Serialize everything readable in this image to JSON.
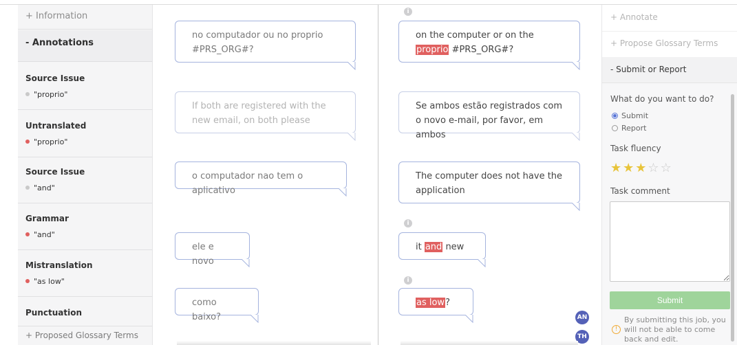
{
  "left_panel": {
    "information_label": "+ Information",
    "annotations_label": "-  Annotations",
    "annotations": [
      {
        "category": "Source Issue",
        "value": "\"proprio\"",
        "dot_color": "#c9c9c9"
      },
      {
        "category": "Untranslated",
        "value": "\"proprio\"",
        "dot_color": "#e0605f"
      },
      {
        "category": "Source Issue",
        "value": "\"and\"",
        "dot_color": "#c9c9c9"
      },
      {
        "category": "Grammar",
        "value": "\"and\"",
        "dot_color": "#e0605f"
      },
      {
        "category": "Mistranslation",
        "value": "\"as low\"",
        "dot_color": "#e0605f"
      },
      {
        "category": "Punctuation",
        "value": "",
        "dot_color": "#c9c9c9"
      }
    ],
    "proposed_glossary_label": "+ Proposed Glossary Terms"
  },
  "segments": {
    "s1": {
      "source": "no computador ou no proprio #PRS_ORG#?",
      "target_pre": "on the computer or on the ",
      "target_hl": "proprio",
      "target_post": " #PRS_ORG#?"
    },
    "s2": {
      "source": "If both are registered with the new email, on both please",
      "target": "Se ambos estão registrados com o novo e-mail, por favor, em ambos"
    },
    "s3": {
      "source": "o computador nao tem o aplicativo",
      "target": "The computer does not have the application"
    },
    "s4": {
      "source": "ele e novo",
      "target_pre": "it ",
      "target_hl": "and",
      "target_post": " new"
    },
    "s5": {
      "source": "como baixo?",
      "target_hl": "as low",
      "target_post": "?"
    }
  },
  "info_icon": "i",
  "avatars": [
    "AN",
    "TH"
  ],
  "right_panel": {
    "annotate_label": "+ Annotate",
    "propose_label": "+ Propose Glossary Terms",
    "submit_report_label": "-  Submit or Report",
    "question": "What do you want to do?",
    "options": [
      "Submit",
      "Report"
    ],
    "selected_option": "Submit",
    "fluency_label": "Task fluency",
    "fluency_rating": 3,
    "fluency_max": 5,
    "comment_label": "Task comment",
    "comment_value": "",
    "submit_button": "Submit",
    "warning": "By submitting this job, you will not be able to come back and edit.",
    "warning_icon": "!"
  },
  "colors": {
    "highlight": "#e0605f",
    "submit_green": "#9fd49b",
    "avatar": "#5461b7",
    "bubble_border": "#a4b3de"
  }
}
